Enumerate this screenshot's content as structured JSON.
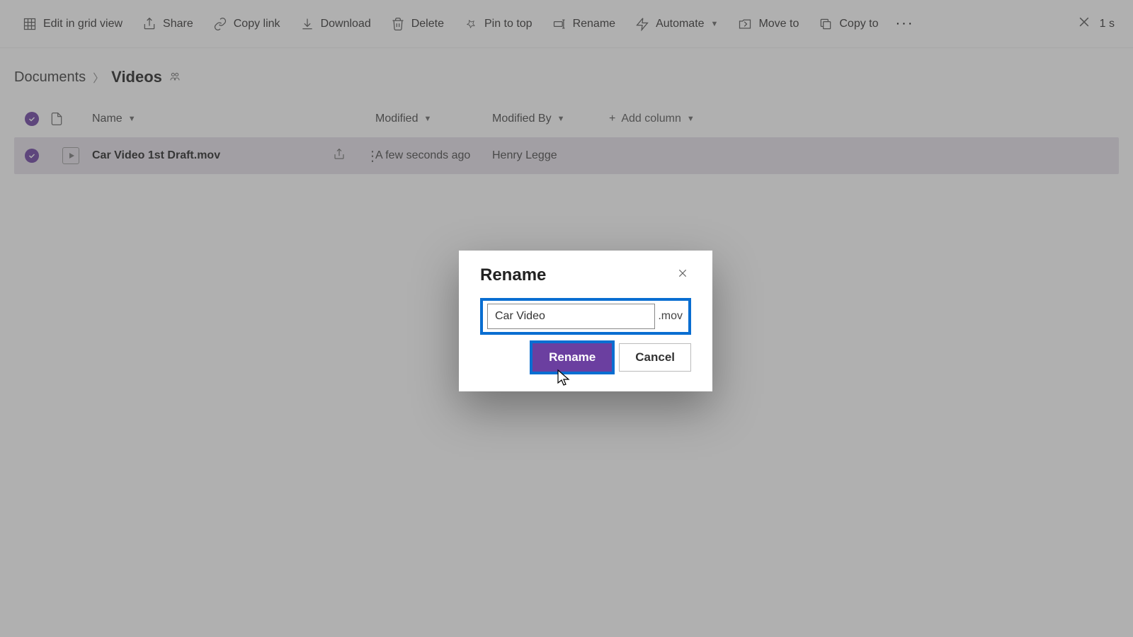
{
  "toolbar": {
    "edit_grid": "Edit in grid view",
    "share": "Share",
    "copy_link": "Copy link",
    "download": "Download",
    "delete": "Delete",
    "pin": "Pin to top",
    "rename": "Rename",
    "automate": "Automate",
    "move": "Move to",
    "copy": "Copy to",
    "selection_count": "1 s"
  },
  "breadcrumb": {
    "root": "Documents",
    "current": "Videos"
  },
  "columns": {
    "name": "Name",
    "modified": "Modified",
    "modified_by": "Modified By",
    "add_column": "Add column"
  },
  "row": {
    "filename": "Car Video 1st Draft.mov",
    "modified": "A few seconds ago",
    "modified_by": "Henry Legge"
  },
  "dialog": {
    "title": "Rename",
    "input_value": "Car Video",
    "extension": ".mov",
    "rename_btn": "Rename",
    "cancel_btn": "Cancel"
  }
}
